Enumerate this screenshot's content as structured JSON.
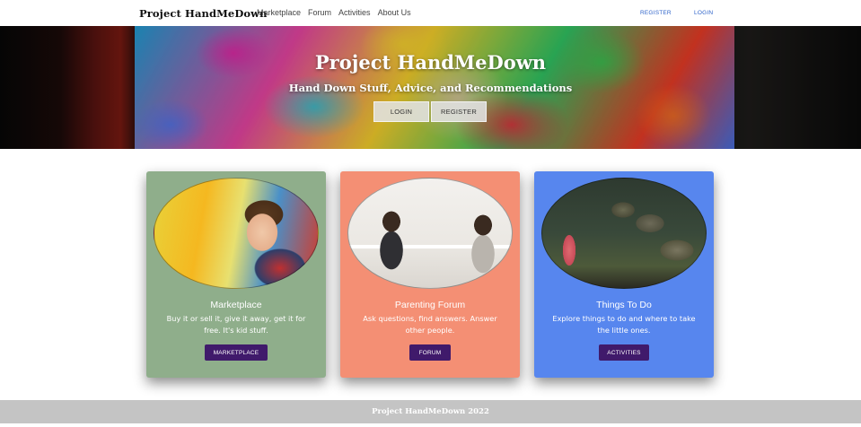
{
  "navbar": {
    "brand": "Project HandMeDown",
    "links": [
      "Marketplace",
      "Forum",
      "Activities",
      "About Us"
    ],
    "register_label": "REGISTER",
    "login_label": "LOGIN"
  },
  "hero": {
    "title": "Project HandMeDown",
    "subtitle": "Hand Down Stuff, Advice, and Recommendations",
    "login_label": "LOGIN",
    "register_label": "REGISTER"
  },
  "cards": [
    {
      "title": "Marketplace",
      "description": "Buy it or sell it, give it away, get it for free. It's kid stuff.",
      "button_label": "MARKETPLACE",
      "color": "#8fae8b"
    },
    {
      "title": "Parenting Forum",
      "description": "Ask questions, find answers. Answer other people.",
      "button_label": "FORUM",
      "color": "#f48f74"
    },
    {
      "title": "Things To Do",
      "description": "Explore things to do and where to take the little ones.",
      "button_label": "ACTIVITIES",
      "color": "#5786ee"
    }
  ],
  "colors": {
    "button": "#401a6b",
    "nav_accent": "#2e63c9",
    "footer": "#c4c4c4"
  },
  "footer": {
    "text": "Project HandMeDown 2022"
  }
}
